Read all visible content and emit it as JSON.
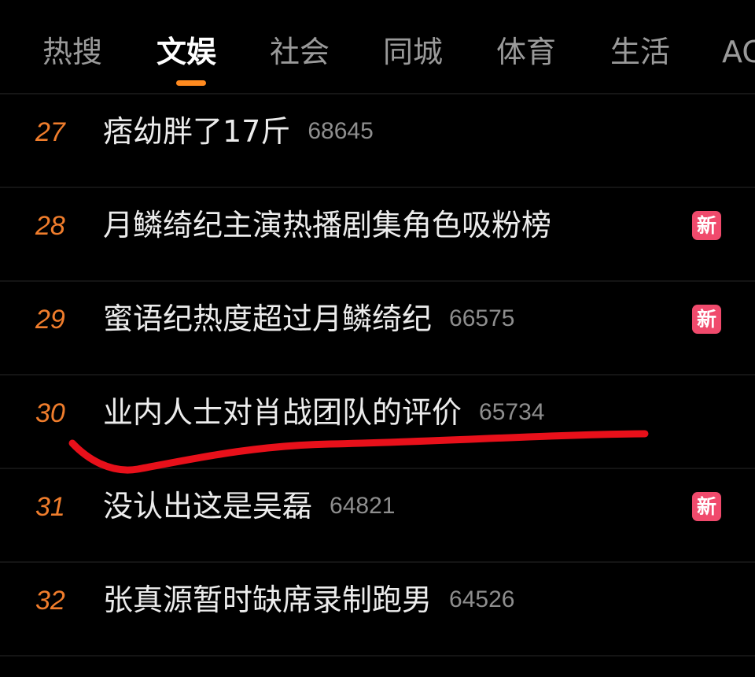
{
  "tabs": [
    {
      "label": "热搜",
      "active": false
    },
    {
      "label": "文娱",
      "active": true
    },
    {
      "label": "社会",
      "active": false
    },
    {
      "label": "同城",
      "active": false
    },
    {
      "label": "体育",
      "active": false
    },
    {
      "label": "生活",
      "active": false
    },
    {
      "label": "AC",
      "active": false
    }
  ],
  "list": {
    "rows": [
      {
        "rank": "27",
        "title": "痞幼胖了17斤",
        "heat": "68645",
        "badge": ""
      },
      {
        "rank": "28",
        "title": "月鳞绮纪主演热播剧集角色吸粉榜",
        "heat": "",
        "badge": "新"
      },
      {
        "rank": "29",
        "title": "蜜语纪热度超过月鳞绮纪",
        "heat": "66575",
        "badge": "新"
      },
      {
        "rank": "30",
        "title": "业内人士对肖战团队的评价",
        "heat": "65734",
        "badge": ""
      },
      {
        "rank": "31",
        "title": "没认出这是吴磊",
        "heat": "64821",
        "badge": "新"
      },
      {
        "rank": "32",
        "title": "张真源暂时缺席录制跑男",
        "heat": "64526",
        "badge": ""
      }
    ]
  },
  "colors": {
    "background": "#000000",
    "rank": "#f07d2c",
    "tab_indicator": "#ff8a1f",
    "new_badge": "#f04a6c",
    "annotation_stroke": "#e8101a"
  }
}
